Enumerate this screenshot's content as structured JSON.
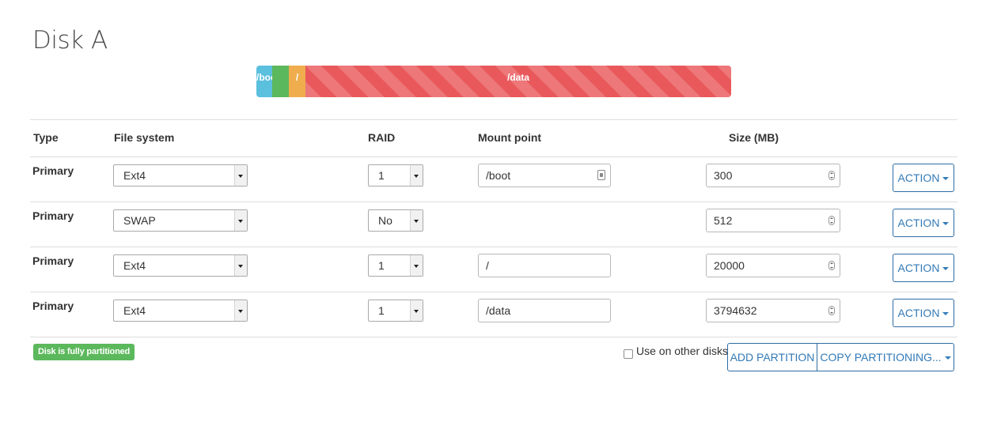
{
  "disk": {
    "title": "Disk A"
  },
  "partition_bar": {
    "segments": [
      {
        "label": "/boot",
        "color": "#5bc0de",
        "size_mb": 300
      },
      {
        "label": "",
        "color": "#5cb85c",
        "size_mb": 512
      },
      {
        "label": "/",
        "color": "#f0ad4e",
        "size_mb": 20000
      },
      {
        "label": "/data",
        "color": "#e9595b",
        "size_mb": 3794632
      }
    ]
  },
  "table": {
    "headers": {
      "type": "Type",
      "filesystem": "File system",
      "raid": "RAID",
      "mount": "Mount point",
      "size": "Size (MB)"
    },
    "rows": [
      {
        "type": "Primary",
        "filesystem": "Ext4",
        "raid": "1",
        "mount": "/boot",
        "size": "300",
        "action": "ACTION"
      },
      {
        "type": "Primary",
        "filesystem": "SWAP",
        "raid": "No",
        "mount": "",
        "size": "512",
        "action": "ACTION"
      },
      {
        "type": "Primary",
        "filesystem": "Ext4",
        "raid": "1",
        "mount": "/",
        "size": "20000",
        "action": "ACTION"
      },
      {
        "type": "Primary",
        "filesystem": "Ext4",
        "raid": "1",
        "mount": "/data",
        "size": "3794632",
        "action": "ACTION"
      }
    ]
  },
  "footer": {
    "status_badge": "Disk is fully partitioned",
    "status_color": "#5cb85c",
    "use_on_other_disks_label": "Use on other disks",
    "use_on_other_disks_checked": false,
    "add_partition_label": "ADD PARTITION",
    "copy_partitioning_label": "COPY PARTITIONING..."
  },
  "colors": {
    "accent": "#337ab7"
  }
}
